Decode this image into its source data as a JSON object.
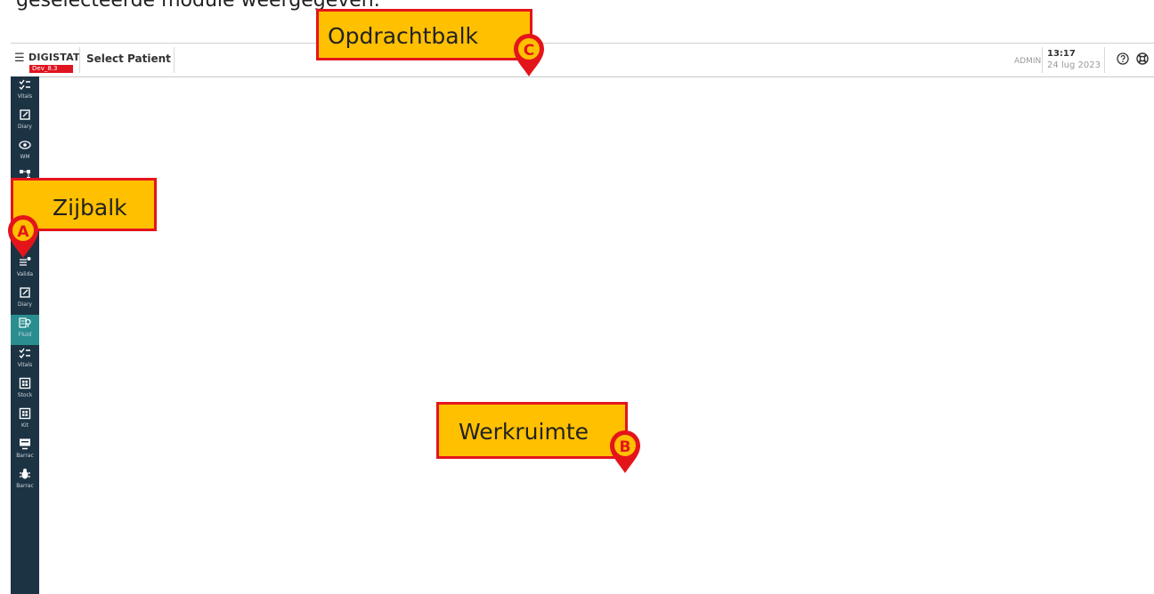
{
  "caption": "geselecteerde module weergegeven.",
  "topbar": {
    "menu_icon": "hamburger-icon",
    "brand": "DIGISTAT",
    "version": "Dev_8.3",
    "page_title": "Select Patient",
    "user": "ADMIN",
    "time": "13:17",
    "date": "24 lug 2023",
    "help_icon": "help-icon",
    "settings_icon": "lifebuoy-icon"
  },
  "sidebar": {
    "items": [
      {
        "label": "Vitals",
        "icon": "checklist-icon"
      },
      {
        "label": "Diary",
        "icon": "edit-icon"
      },
      {
        "label": "WM",
        "icon": "eye-icon"
      },
      {
        "label": "",
        "icon": "network-icon"
      },
      {
        "label": "Valida",
        "icon": "list-check-icon"
      },
      {
        "label": "Diary",
        "icon": "edit-icon"
      },
      {
        "label": "Fluid",
        "icon": "fluid-balance-icon",
        "active": true
      },
      {
        "label": "Vitals",
        "icon": "checklist-icon"
      },
      {
        "label": "Stock",
        "icon": "grid-icon"
      },
      {
        "label": "Kit",
        "icon": "grid-icon"
      },
      {
        "label": "Barrac",
        "icon": "monitor-icon"
      },
      {
        "label": "Barrac",
        "icon": "bug-icon"
      }
    ]
  },
  "annotations": {
    "a": {
      "label": "Zijbalk",
      "marker": "A"
    },
    "b": {
      "label": "Werkruimte",
      "marker": "B"
    },
    "c": {
      "label": "Opdrachtbalk",
      "marker": "C"
    }
  },
  "colors": {
    "sidebar_bg": "#1c3344",
    "active_item": "#2a8e91",
    "callout_fill": "#ffc000",
    "callout_border": "#e3151b",
    "version_badge": "#e0141e"
  }
}
